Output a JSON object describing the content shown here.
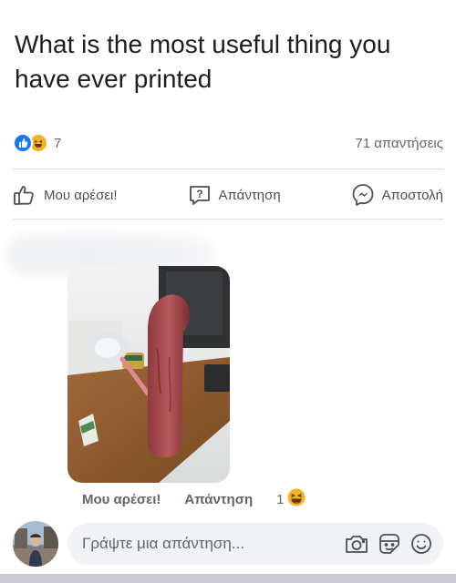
{
  "post": {
    "text": "What is the most useful thing you have ever printed"
  },
  "stats": {
    "reaction_count": "7",
    "comments_label": "71 απαντήσεις",
    "reactions": [
      "like-icon",
      "haha-icon"
    ]
  },
  "actions": {
    "like_label": "Μου αρέσει!",
    "reply_label": "Απάντηση",
    "share_label": "Αποστολή"
  },
  "comment": {
    "like_label": "Μου αρέσει!",
    "reply_label": "Απάντηση",
    "reaction_count": "1",
    "reaction": "haha-icon"
  },
  "composer": {
    "placeholder": "Γράψτε μια απάντηση..."
  },
  "colors": {
    "brand": "#1877f2",
    "haha": "#f7b125",
    "secondary_text": "#606770"
  }
}
